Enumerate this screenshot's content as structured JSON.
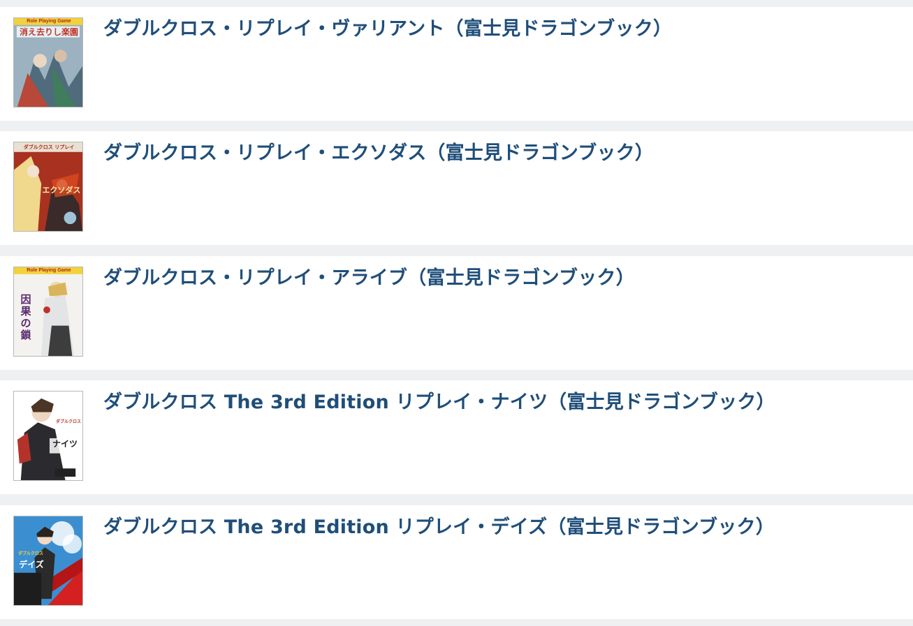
{
  "books": [
    {
      "title": "ダブルクロス・リプレイ・ヴァリアント（富士見ドラゴンブック）",
      "cover": {
        "banner_text": "Role Playing Game",
        "cover_title": "消え去りし楽園",
        "bg": "#8aa3b3",
        "accent": "#e8c23a"
      }
    },
    {
      "title": "ダブルクロス・リプレイ・エクソダス（富士見ドラゴンブック）",
      "cover": {
        "banner_text": "ダブルクロス リプレイ",
        "cover_title": "エクソダス",
        "bg": "#b53a24",
        "accent": "#f0d27a"
      }
    },
    {
      "title": "ダブルクロス・リプレイ・アライブ（富士見ドラゴンブック）",
      "cover": {
        "banner_text": "Role Playing Game",
        "cover_title": "因果の鎖",
        "bg": "#f3f1ec",
        "accent": "#e8c23a"
      }
    },
    {
      "title": "ダブルクロス The 3rd Edition リプレイ・ナイツ（富士見ドラゴンブック）",
      "cover": {
        "banner_text": "ダブルクロス",
        "cover_title": "ナイツ",
        "bg": "#ffffff",
        "accent": "#b5322a"
      }
    },
    {
      "title": "ダブルクロス The 3rd Edition リプレイ・デイズ（富士見ドラゴンブック）",
      "cover": {
        "banner_text": "ダブルクロス",
        "cover_title": "デイズ",
        "bg": "#3b8fd1",
        "accent": "#d42020"
      }
    }
  ]
}
